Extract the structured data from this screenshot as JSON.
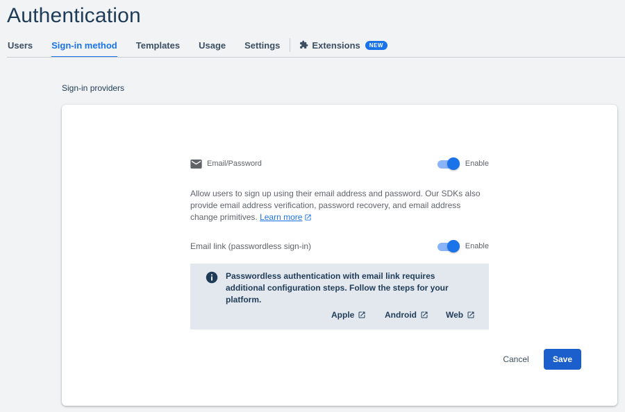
{
  "page": {
    "title": "Authentication"
  },
  "tabs": [
    {
      "label": "Users",
      "active": false
    },
    {
      "label": "Sign-in method",
      "active": true
    },
    {
      "label": "Templates",
      "active": false
    },
    {
      "label": "Usage",
      "active": false
    },
    {
      "label": "Settings",
      "active": false
    }
  ],
  "extensions_tab": {
    "label": "Extensions",
    "badge": "NEW",
    "icon": "puzzle-icon"
  },
  "section": {
    "title": "Sign-in providers"
  },
  "provider": {
    "icon": "mail-icon",
    "name": "Email/Password",
    "enabled": true,
    "toggle_label": "Enable",
    "description": "Allow users to sign up using their email address and password. Our SDKs also provide email address verification, password recovery, and email address change primitives.",
    "learn_more": "Learn more"
  },
  "email_link": {
    "name": "Email link (passwordless sign-in)",
    "enabled": true,
    "toggle_label": "Enable"
  },
  "info": {
    "icon": "info-icon",
    "text": "Passwordless authentication with email link requires additional configuration steps. Follow the steps for your platform.",
    "links": [
      "Apple",
      "Android",
      "Web"
    ]
  },
  "actions": {
    "cancel": "Cancel",
    "save": "Save"
  },
  "colors": {
    "accent": "#1a73e8",
    "title": "#1f3b57",
    "info_bg": "#e3e8ef",
    "page_bg": "#f1f3f4"
  }
}
